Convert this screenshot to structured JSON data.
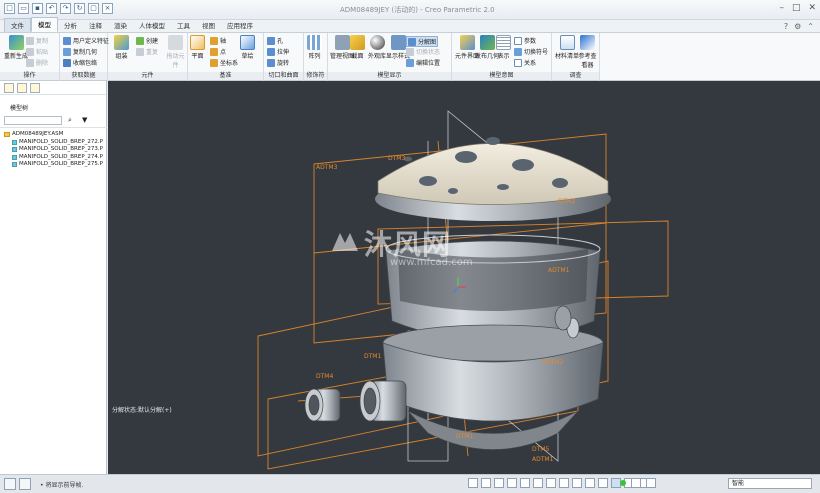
{
  "window": {
    "title": "ADM08489JEY (活动的) - Creo Parametric 2.0"
  },
  "tabs": [
    {
      "label": "文件",
      "state": "file"
    },
    {
      "label": "模型",
      "state": "active"
    },
    {
      "label": "分析",
      "state": ""
    },
    {
      "label": "注释",
      "state": ""
    },
    {
      "label": "渲染",
      "state": ""
    },
    {
      "label": "人体模型",
      "state": ""
    },
    {
      "label": "工具",
      "state": ""
    },
    {
      "label": "视图",
      "state": ""
    },
    {
      "label": "应用程序",
      "state": ""
    }
  ],
  "ribbon": {
    "groups": {
      "operations": "操作",
      "get_data": "获取数据",
      "component": "元件",
      "datum": "基准",
      "cut_surface": "切口和曲面",
      "modifiers": "修饰符",
      "model_display": "模型显示",
      "model_intent": "模型意图",
      "investigate": "调查"
    },
    "regenerate": "重新生成",
    "copy": "复制",
    "paste": "粘贴",
    "delete": "删除",
    "user_feature": "用户定义特征",
    "copy_geometry": "复制几何",
    "shrinkwrap": "收缩包络",
    "assemble": "组装",
    "create": "创建",
    "repeat": "重复",
    "drag_components": "拖动元件",
    "plane": "平面",
    "axis": "轴",
    "point": "点",
    "csys": "坐标系",
    "sketch": "草绘",
    "hole": "孔",
    "extrude": "拉伸",
    "revolve": "旋转",
    "pattern": "阵列",
    "manage_views": "管理视图",
    "section": "截面",
    "appearance_gallery": "外观库",
    "display_style": "显示样式",
    "explode_view": "分解图",
    "toggle_status": "切换状态",
    "edit_position": "编辑位置",
    "family_table": "元件界面",
    "publish_geometry": "发布几何",
    "parameters": "参数",
    "switch_symbols": "切换符号",
    "relations": "关系",
    "bom": "材料清单",
    "reference_viewer": "参考查看器",
    "table": "表示"
  },
  "model_tree": {
    "title": "模型树",
    "items": [
      {
        "label": "ADM08489JEY.ASM",
        "kind": "asm"
      },
      {
        "label": "MANIFOLD_SOLID_BREP_272.P",
        "kind": "prt"
      },
      {
        "label": "MANIFOLD_SOLID_BREP_273.P",
        "kind": "prt"
      },
      {
        "label": "MANIFOLD_SOLID_BREP_274.P",
        "kind": "prt"
      },
      {
        "label": "MANIFOLD_SOLID_BREP_275.P",
        "kind": "prt"
      }
    ]
  },
  "viewport": {
    "status_text": "分解状态:默认分解(+)",
    "watermark": "沐风网",
    "watermark_url": "www.mfcad.com",
    "datums": [
      "ADTM3",
      "DTM3",
      "DTM2",
      "ADTM1",
      "DTM1",
      "ADTM2",
      "DTM4",
      "DTM1",
      "DTM5",
      "ADTM1"
    ]
  },
  "statusbar": {
    "message": "• 将显示前导帧.",
    "filter": "智能"
  }
}
